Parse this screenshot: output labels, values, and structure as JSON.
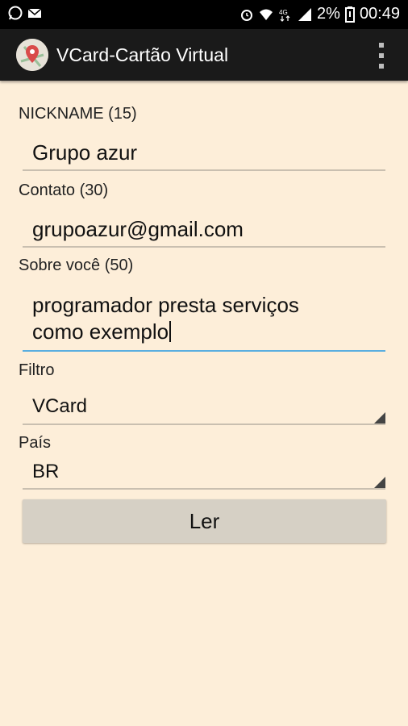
{
  "status_bar": {
    "left_icons": [
      "whatsapp-icon",
      "mail-icon"
    ],
    "right_icons": [
      "alarm-icon",
      "wifi-icon",
      "4g-icon",
      "signal-icon",
      "battery-icon"
    ],
    "battery": "2%",
    "time": "00:49"
  },
  "toolbar": {
    "title": "VCard-Cartão Virtual",
    "icon": "map-pin-icon",
    "menu_icon": "overflow-menu-icon"
  },
  "form": {
    "nickname_label": "NICKNAME (15)",
    "nickname_value": "Grupo azur",
    "contact_label": "Contato (30)",
    "contact_value": "grupoazur@gmail.com",
    "about_label": "Sobre você  (50)",
    "about_line1": "programador  presta serviços",
    "about_line2": "como exemplo",
    "filter_label": "Filtro",
    "filter_value": "VCard",
    "country_label": "País",
    "country_value": "BR",
    "read_button": "Ler"
  },
  "colors": {
    "background": "#fdeed9",
    "toolbar": "#1a1a1a",
    "focus_underline": "#5aaee0",
    "button": "#d6d0c5"
  }
}
